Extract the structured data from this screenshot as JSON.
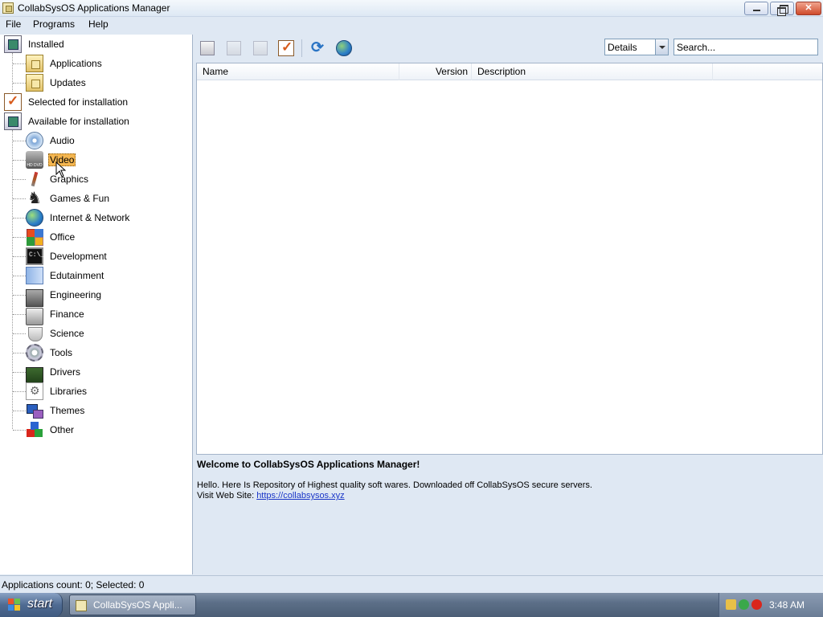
{
  "window": {
    "title": "CollabSysOS Applications Manager"
  },
  "menu": [
    "File",
    "Programs",
    "Help"
  ],
  "tree": {
    "installed": "Installed",
    "applications": "Applications",
    "updates": "Updates",
    "selected": "Selected for installation",
    "available": "Available for installation",
    "categories": [
      {
        "label": "Audio",
        "icon": "audio-disc-icon"
      },
      {
        "label": "Video",
        "icon": "hd-dvd-icon",
        "selected": true
      },
      {
        "label": "Graphics",
        "icon": "paintbrush-icon"
      },
      {
        "label": "Games & Fun",
        "icon": "chess-knight-icon"
      },
      {
        "label": "Internet & Network",
        "icon": "globe-icon"
      },
      {
        "label": "Office",
        "icon": "office-squares-icon"
      },
      {
        "label": "Development",
        "icon": "console-icon"
      },
      {
        "label": "Edutainment",
        "icon": "book-icon"
      },
      {
        "label": "Engineering",
        "icon": "computer-icon"
      },
      {
        "label": "Finance",
        "icon": "cash-register-icon"
      },
      {
        "label": "Science",
        "icon": "flask-icon"
      },
      {
        "label": "Tools",
        "icon": "gear-icon"
      },
      {
        "label": "Drivers",
        "icon": "circuit-card-icon"
      },
      {
        "label": "Libraries",
        "icon": "library-gear-icon"
      },
      {
        "label": "Themes",
        "icon": "themes-icon"
      },
      {
        "label": "Other",
        "icon": "blocks-icon"
      }
    ]
  },
  "toolbar": {
    "view_value": "Details",
    "search_placeholder": "Search..."
  },
  "list": {
    "columns": [
      "Name",
      "Version",
      "Description"
    ]
  },
  "info": {
    "welcome": "Welcome to CollabSysOS Applications Manager!",
    "line1": "Hello. Here Is Repository of Highest quality soft wares. Downloaded off CollabSysOS secure servers.",
    "visit_label": "Visit Web Site: ",
    "link": "https://collabsysos.xyz"
  },
  "status": {
    "text": "Applications count: 0; Selected: 0"
  },
  "taskbar": {
    "start": "start",
    "task": "CollabSysOS Appli...",
    "clock": "3:48 AM"
  }
}
